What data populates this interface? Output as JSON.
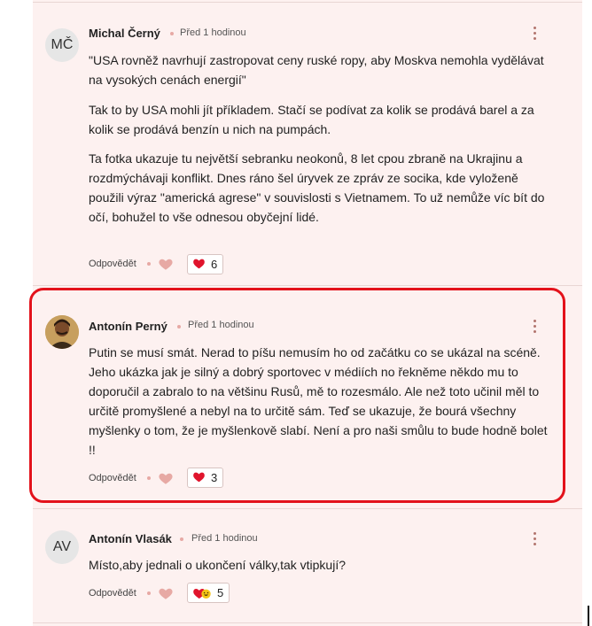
{
  "comments": [
    {
      "initials": "MČ",
      "author": "Michal Černý",
      "time": "Před 1 hodinou",
      "paragraphs": [
        "\"USA rovněž navrhují zastropovat ceny ruské ropy, aby Moskva nemohla vydělávat na vysokých cenách energií\"",
        "Tak to by USA mohli jít příkladem. Stačí se podívat za kolik se prodává barel a za kolik se prodává benzín u nich na pumpách.",
        "Ta fotka ukazuje tu největší sebranku neokonů, 8 let cpou zbraně na Ukrajinu a rozdmýchávaji konflikt. Dnes ráno šel úryvek ze zpráv ze socika, kde vyloženě použili výraz \"americká agrese\" v souvislosti s Vietnamem. To už nemůže víc bít do očí, bohužel to vše odnesou obyčejní lidé."
      ],
      "reply": "Odpovědět",
      "reaction_count": "6"
    },
    {
      "author": "Antonín Perný",
      "time": "Před 1 hodinou",
      "paragraphs": [
        "Putin se musí smát. Nerad to píšu nemusím ho od začátku co se ukázal na scéně. Jeho ukázka jak je silný a dobrý sportovec v médiích no řekněme někdo mu to doporučil a zabralo to na většinu Rusů, mě to rozesmálo. Ale než toto učinil měl to určitě promyšlené a nebyl na to určitě sám. Teď se ukazuje, že bourá všechny myšlenky o tom, že je myšlenkově slabí. Není a pro naši smůlu to bude hodně bolet !!"
      ],
      "reply": "Odpovědět",
      "reaction_count": "3"
    },
    {
      "initials": "AV",
      "author": "Antonín Vlasák",
      "time": "Před 1 hodinou",
      "paragraphs": [
        "Místo,aby jednali o ukončení války,tak vtipkují?"
      ],
      "reply": "Odpovědět",
      "reaction_count": "5"
    }
  ],
  "colors": {
    "panel_bg": "#fdf1f0",
    "highlight_border": "#e3121b",
    "heart_red": "#e0142c",
    "heart_outline": "#e7a9a4"
  },
  "icons": [
    "avatar-photo",
    "more-options-icon",
    "like-heart-icon",
    "heart-reaction-icon",
    "laugh-reaction-icon"
  ]
}
